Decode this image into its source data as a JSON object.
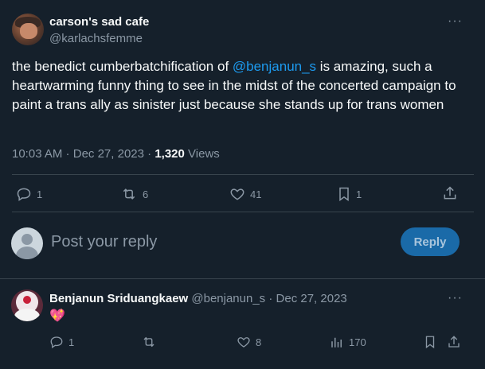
{
  "tweet": {
    "author_name": "carson's sad cafe",
    "author_handle": "@karlachsfemme",
    "text_before": "the benedict cumberbatchification of ",
    "mention": "@benjanun_s",
    "text_after": " is amazing, such a heartwarming funny thing to see in the midst of the concerted campaign to paint a trans ally as sinister just because she stands up for trans women",
    "time": "10:03 AM",
    "date": "Dec 27, 2023",
    "views_count": "1,320",
    "views_label": "Views",
    "more": "···",
    "actions": {
      "replies": "1",
      "reposts": "6",
      "likes": "41",
      "bookmarks": "1"
    }
  },
  "composer": {
    "placeholder": "Post your reply",
    "button_label": "Reply"
  },
  "reply": {
    "author_name": "Benjanun Sriduangkaew",
    "author_handle": "@benjanun_s",
    "separator": "·",
    "date": "Dec 27, 2023",
    "content": "💖",
    "more": "···",
    "actions": {
      "replies": "1",
      "likes": "8",
      "views": "170"
    }
  },
  "colors": {
    "background": "#15202b",
    "accent": "#1d9bf0",
    "muted": "#8b98a5",
    "divider": "#38444d"
  },
  "icons": [
    "reply-icon",
    "repost-icon",
    "like-icon",
    "bookmark-icon",
    "share-icon",
    "analytics-icon",
    "more-icon"
  ]
}
